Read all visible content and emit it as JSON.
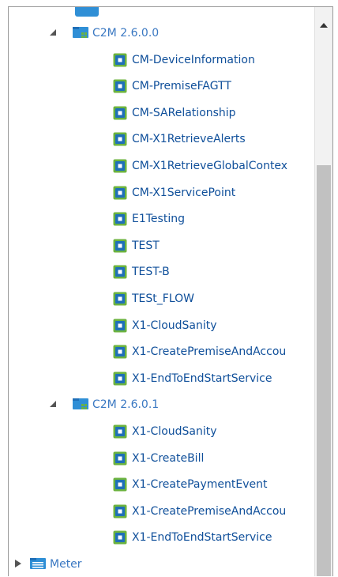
{
  "tree": {
    "groups": [
      {
        "label": "C2M 2.6.0.0",
        "state": "expanded",
        "items": [
          "CM-DeviceInformation",
          "CM-PremiseFAGTT",
          "CM-SARelationship",
          "CM-X1RetrieveAlerts",
          "CM-X1RetrieveGlobalContex",
          "CM-X1ServicePoint",
          "E1Testing",
          "TEST",
          "TEST-B",
          "TESt_FLOW",
          "X1-CloudSanity",
          "X1-CreatePremiseAndAccou",
          "X1-EndToEndStartService"
        ]
      },
      {
        "label": "C2M 2.6.0.1",
        "state": "expanded",
        "items": [
          "X1-CloudSanity",
          "X1-CreateBill",
          "X1-CreatePaymentEvent",
          "X1-CreatePremiseAndAccou",
          "X1-EndToEndStartService"
        ]
      }
    ],
    "meter": {
      "label": "Meter",
      "state": "collapsed"
    }
  },
  "colors": {
    "accent": "#2f8fd6",
    "folder_blue": "#2f8fd6",
    "flow_green": "#6cb33f",
    "flow_blue": "#1f6fb8",
    "text_blue": "#0f4f9a"
  },
  "icons": {
    "group": "version-folder-icon",
    "leaf": "flow-icon",
    "meter": "folder-icon"
  }
}
